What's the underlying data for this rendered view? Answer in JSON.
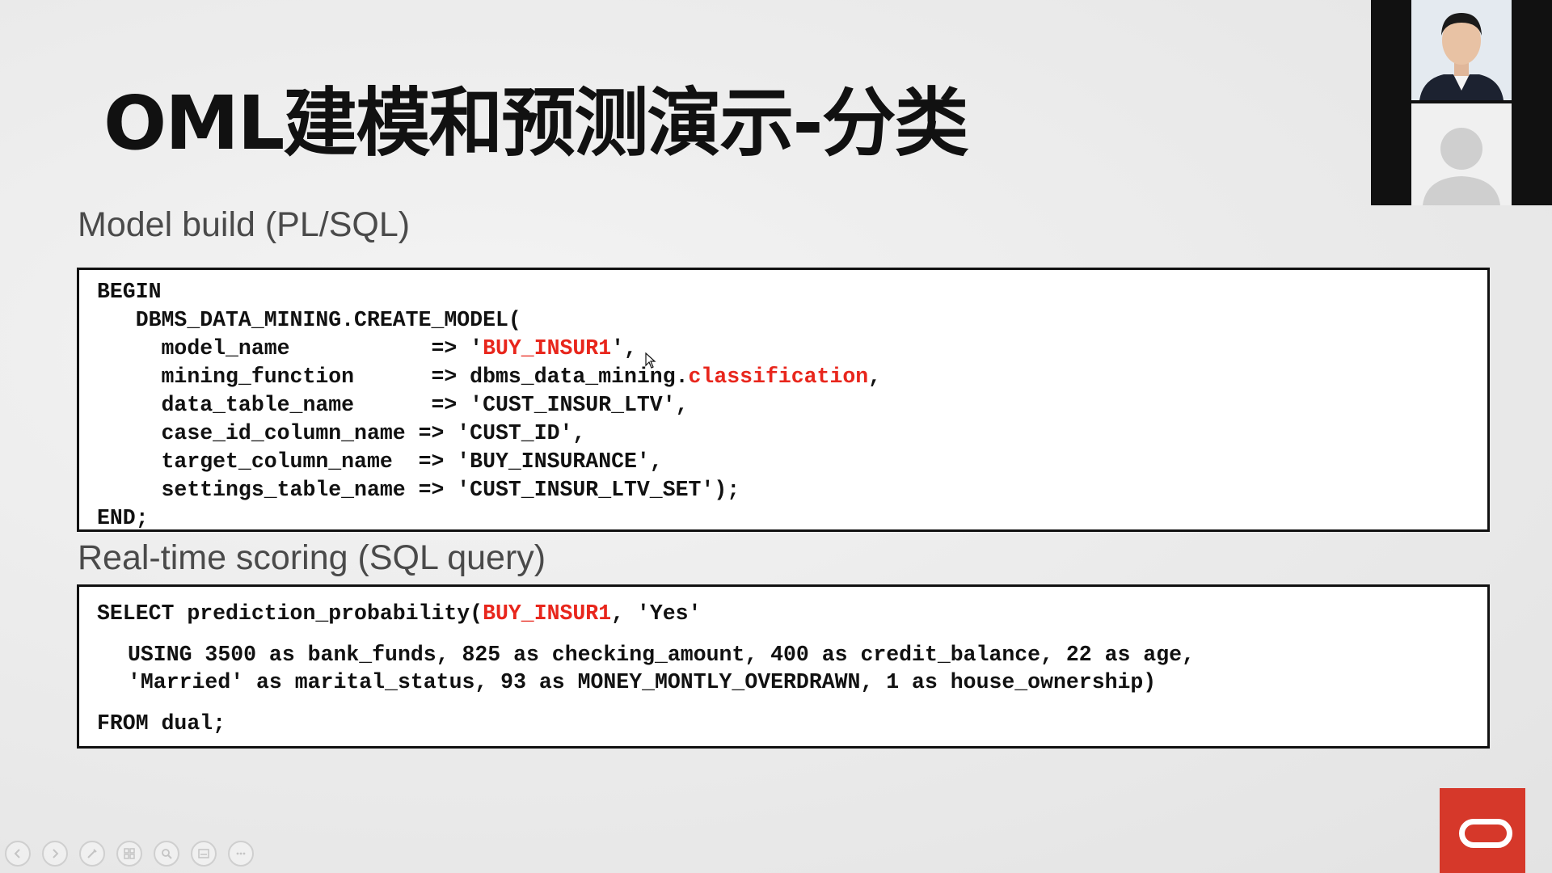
{
  "slide": {
    "title": "OML建模和预测演示-分类",
    "build_heading": "Model build (PL/SQL)",
    "scoring_heading": "Real-time scoring (SQL query)"
  },
  "build_code": {
    "l1": "BEGIN",
    "l2": "   DBMS_DATA_MINING.CREATE_MODEL(",
    "l3_a": "     model_name           => '",
    "l3_hl": "BUY_INSUR1",
    "l3_b": "',",
    "l4_a": "     mining_function      => dbms_data_mining.",
    "l4_hl": "classification",
    "l4_b": ",",
    "l5": "     data_table_name      => 'CUST_INSUR_LTV',",
    "l6": "     case_id_column_name => 'CUST_ID',",
    "l7": "     target_column_name  => 'BUY_INSURANCE',",
    "l8": "     settings_table_name => 'CUST_INSUR_LTV_SET');",
    "l9": "END;"
  },
  "score_code": {
    "l1_a": "SELECT prediction_probability(",
    "l1_hl": "BUY_INSUR1",
    "l1_b": ", 'Yes'",
    "l2": "USING 3500 as bank_funds, 825 as checking_amount, 400 as credit_balance, 22 as age,",
    "l3": "'Married' as marital_status, 93 as MONEY_MONTLY_OVERDRAWN, 1 as house_ownership)",
    "l4": "FROM dual;"
  },
  "colors": {
    "highlight": "#e8261c",
    "oracle_red": "#d6382a",
    "code_text": "#111111",
    "heading_text": "#4a4a4a"
  },
  "icons": {
    "slideshow_tools": [
      "previous-icon",
      "next-icon",
      "pen-icon",
      "slides-grid-icon",
      "zoom-icon",
      "subtitles-icon",
      "more-options-icon"
    ],
    "logo": "oracle-logo-icon"
  }
}
